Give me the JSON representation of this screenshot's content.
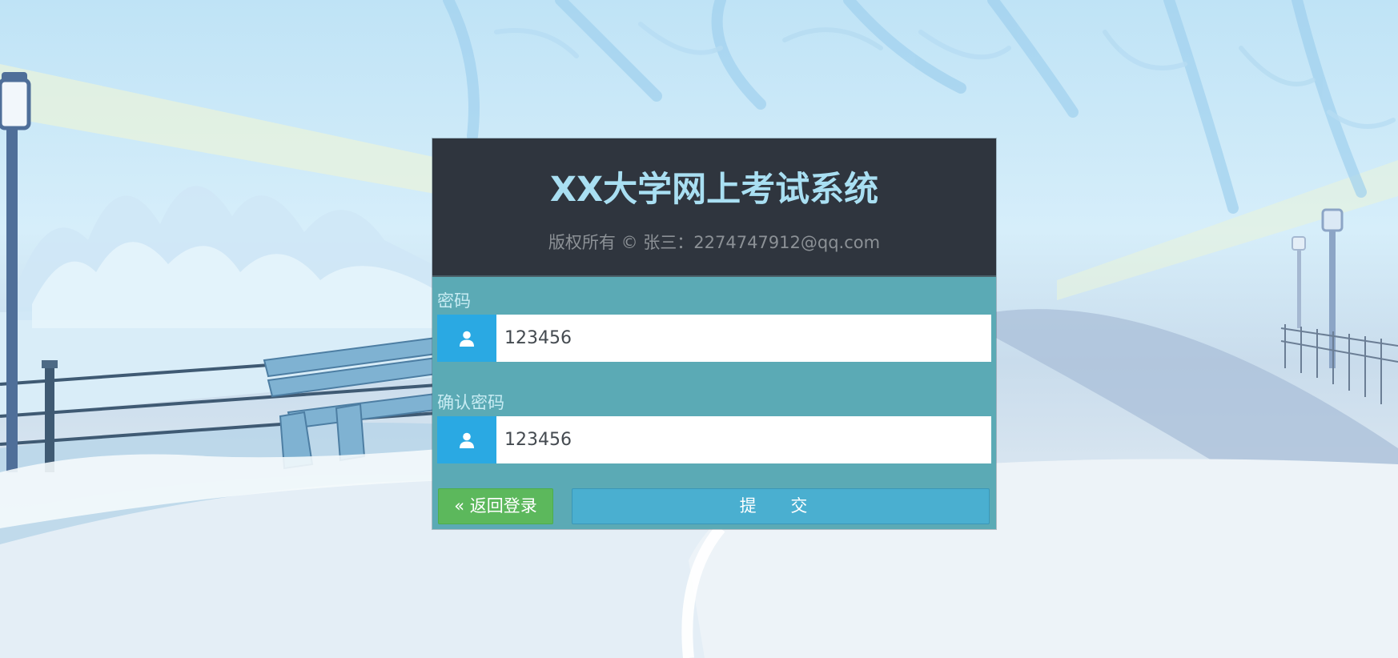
{
  "header": {
    "title": "XX大学网上考试系统",
    "copyright": "版权所有 © 张三：2274747912@qq.com"
  },
  "form": {
    "password": {
      "label": "密码",
      "value": "123456",
      "icon": "user-icon"
    },
    "confirm_password": {
      "label": "确认密码",
      "value": "123456",
      "icon": "user-icon"
    },
    "back_button": "« 返回登录",
    "submit_button": "提 交"
  },
  "colors": {
    "header_bg": "#2f353e",
    "title": "#a9dff2",
    "panel_bg": "#5baab5",
    "addon_bg": "#2aa9e3",
    "back_button": "#5cb85c",
    "submit_button": "#4aafd0"
  }
}
